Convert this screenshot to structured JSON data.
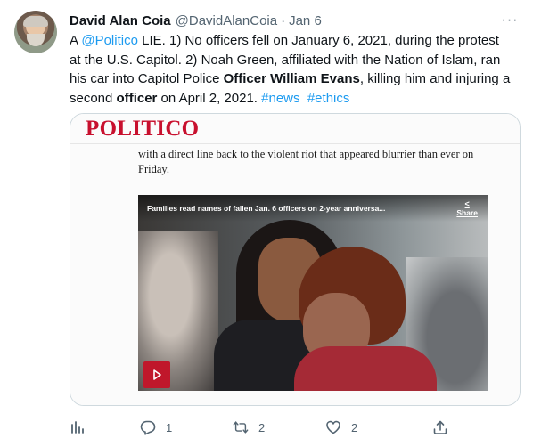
{
  "tweet": {
    "author_name": "David Alan Coia",
    "author_handle": "@DavidAlanCoia",
    "separator": "·",
    "date": "Jan 6",
    "more_label": "···",
    "text": {
      "t1": "A ",
      "mention": "@Politico",
      "t2": " LIE. 1) No officers fell on January 6, 2021, during the protest at the U.S. Capitol. 2) Noah Green, affiliated with the Nation of Islam, ran his car into  Capitol Police ",
      "bold1": "Officer William Evans",
      "t3": ", killing him and injuring a second ",
      "bold2": "officer",
      "t4": " on April 2, 2021. ",
      "hashtag1": "#news",
      "t5": "  ",
      "hashtag2": "#ethics"
    }
  },
  "card": {
    "logo": "POLITICO",
    "article_text": "with a direct line back to the violent riot that appeared blurrier than ever on Friday.",
    "video_title": "Families read names of fallen Jan. 6 officers on 2-year anniversa...",
    "share_icon": "<",
    "share_label": "Share",
    "play_icon": "play-icon"
  },
  "actions": {
    "analytics_count": "",
    "reply_count": "1",
    "retweet_count": "2",
    "like_count": "2",
    "share_count": ""
  },
  "colors": {
    "link": "#1d9bf0",
    "muted": "#536471",
    "politico_red": "#c8102e",
    "play_red": "#c0172b"
  }
}
